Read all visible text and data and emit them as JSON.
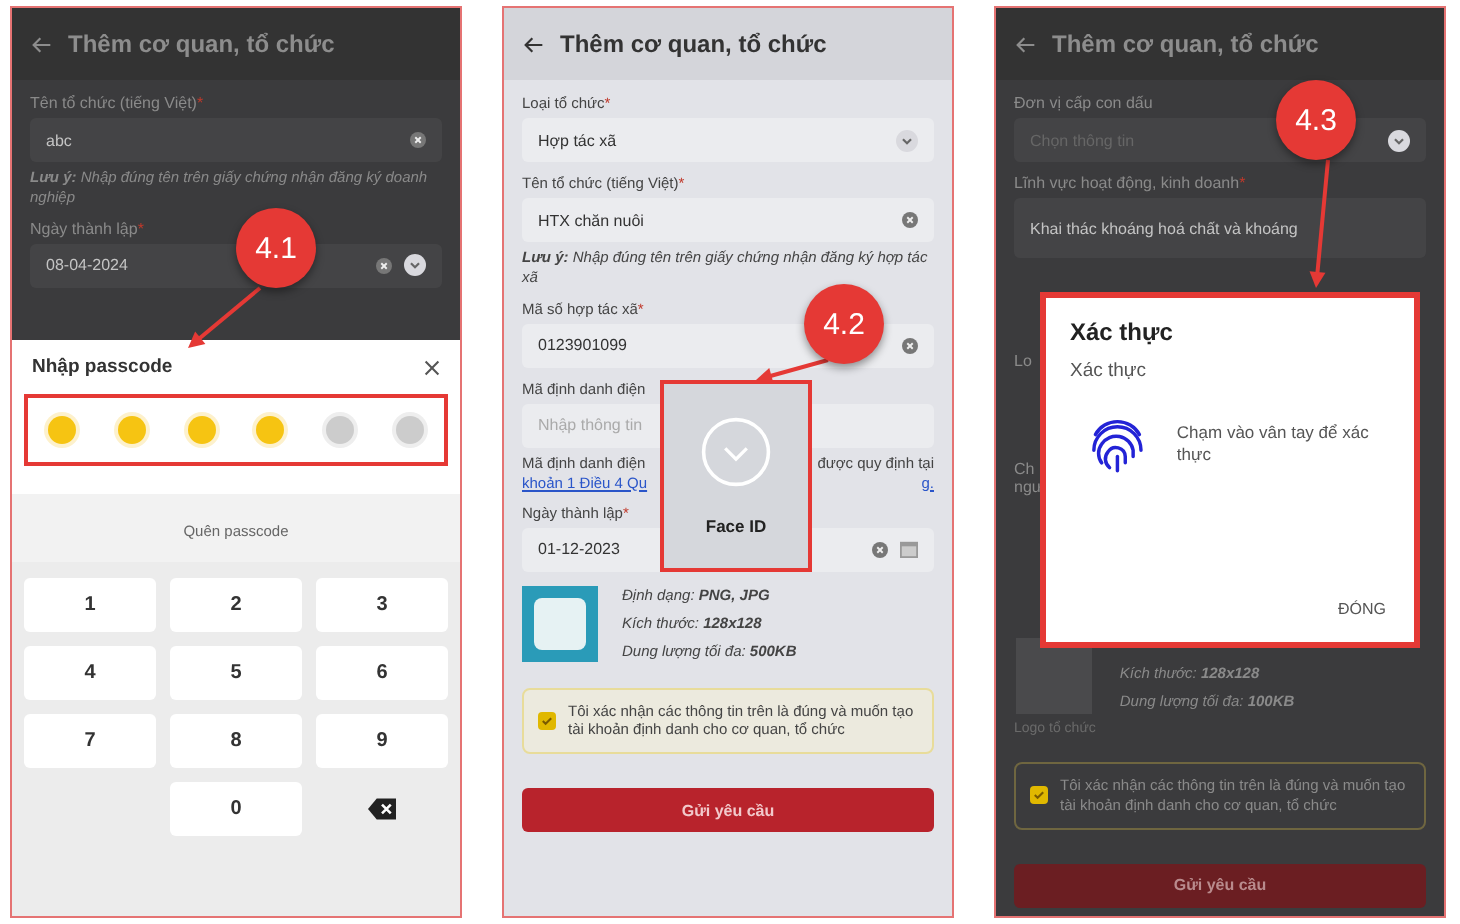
{
  "screens": [
    {
      "kind": "passcode",
      "title": "Thêm cơ quan, tổ chức",
      "callout": "4.1",
      "rows": [
        {
          "kind": "label",
          "text": "Tên tổ chức (tiếng Việt)",
          "mark": "*"
        },
        {
          "kind": "input",
          "value": "abc",
          "clear": true
        },
        {
          "kind": "note",
          "text": "**Lưu ý:** Nhập đúng tên trên giấy chứng nhận đăng ký doanh nghiệp"
        },
        {
          "kind": "label",
          "text": "Ngày thành lập",
          "mark": "*"
        },
        {
          "kind": "input",
          "value": "08-04-2024",
          "clear": true,
          "dropdown": true
        }
      ],
      "sheet": {
        "title": "Nhập passcode",
        "pins": [
          {
            "filled": true
          },
          {
            "filled": true
          },
          {
            "filled": true
          },
          {
            "filled": true
          },
          {
            "filled": false
          },
          {
            "filled": false
          }
        ],
        "forgot": "Quên passcode",
        "keys": [
          {
            "kind": "digit",
            "label": "1"
          },
          {
            "kind": "digit",
            "label": "2"
          },
          {
            "kind": "digit",
            "label": "3"
          },
          {
            "kind": "digit",
            "label": "4"
          },
          {
            "kind": "digit",
            "label": "5"
          },
          {
            "kind": "digit",
            "label": "6"
          },
          {
            "kind": "digit",
            "label": "7"
          },
          {
            "kind": "digit",
            "label": "8"
          },
          {
            "kind": "digit",
            "label": "9"
          },
          {
            "kind": "blank"
          },
          {
            "kind": "digit",
            "label": "0"
          },
          {
            "kind": "backspace"
          }
        ]
      }
    },
    {
      "kind": "faceid",
      "title": "Thêm cơ quan, tổ chức",
      "callout": "4.2",
      "rows": [
        {
          "kind": "label",
          "text": "Loại tổ chức",
          "mark": "*"
        },
        {
          "kind": "select",
          "value": "Hợp tác xã",
          "dropdown": true
        },
        {
          "kind": "label",
          "text": "Tên tổ chức (tiếng Việt)",
          "mark": "*"
        },
        {
          "kind": "input",
          "value": "HTX chăn nuôi",
          "clear": true
        },
        {
          "kind": "note",
          "text": "**Lưu ý:** Nhập đúng tên trên giấy chứng nhận đăng ký hợp tác xã"
        },
        {
          "kind": "label",
          "text": "Mã số hợp tác xã",
          "mark": "*"
        },
        {
          "kind": "input",
          "value": "0123901099",
          "clear": true
        },
        {
          "kind": "label",
          "text": "Mã định danh điện"
        },
        {
          "kind": "input",
          "placeholder": "Nhập thông tin"
        },
        {
          "kind": "split_note",
          "left": "Mã định danh điện",
          "right": "được quy định tại",
          "link_left": "khoản 1 Điều 4 Qu",
          "link_right": "g."
        },
        {
          "kind": "label",
          "text": "Ngày thành lập",
          "mark": "*"
        },
        {
          "kind": "input",
          "value": "01-12-2023",
          "clear": true,
          "calendar": true
        },
        {
          "kind": "image",
          "uploaded": true,
          "bullets": [
            "Định dạng: **PNG, JPG**",
            "Kích thước: **128x128**",
            "Dung lượng tối đa: **500KB**"
          ]
        },
        {
          "kind": "consent",
          "text": "Tôi xác nhận các thông tin trên là đúng và muốn tạo tài khoản định danh cho cơ quan, tổ chức",
          "checked": true
        },
        {
          "kind": "submit",
          "label": "Gửi yêu cầu"
        }
      ],
      "popup": {
        "label": "Face ID"
      }
    },
    {
      "kind": "fingerprint",
      "title": "Thêm cơ quan, tổ chức",
      "callout": "4.3",
      "rows": [
        {
          "kind": "label",
          "text": "Đơn vị cấp con dấu"
        },
        {
          "kind": "select",
          "placeholder": "Chọn thông tin",
          "dropdown": true
        },
        {
          "kind": "label",
          "text": "Lĩnh vực hoạt động, kinh doanh",
          "mark": "*"
        },
        {
          "kind": "input",
          "value": "Khai thác khoáng hoá chất và khoáng"
        },
        {
          "kind": "fragments",
          "lines": [
            "Lo"
          ]
        },
        {
          "kind": "fragments",
          "lines": [
            "Ch",
            "ngư"
          ]
        },
        {
          "kind": "image",
          "uploaded": false,
          "caption": "Logo tổ chức",
          "bullets": [
            "Kích thước: **128x128**",
            "Dung lượng tối đa: **100KB**"
          ]
        },
        {
          "kind": "consent",
          "text": "Tôi xác nhận các thông tin trên là đúng và muốn tạo tài khoản định danh cho cơ quan, tổ chức",
          "checked": true
        },
        {
          "kind": "submit",
          "label": "Gửi yêu cầu"
        }
      ],
      "dialog": {
        "title": "Xác thực",
        "subtitle": "Xác thực",
        "prompt": "Chạm vào vân tay để xác thực",
        "button": "ĐÓNG"
      }
    }
  ]
}
